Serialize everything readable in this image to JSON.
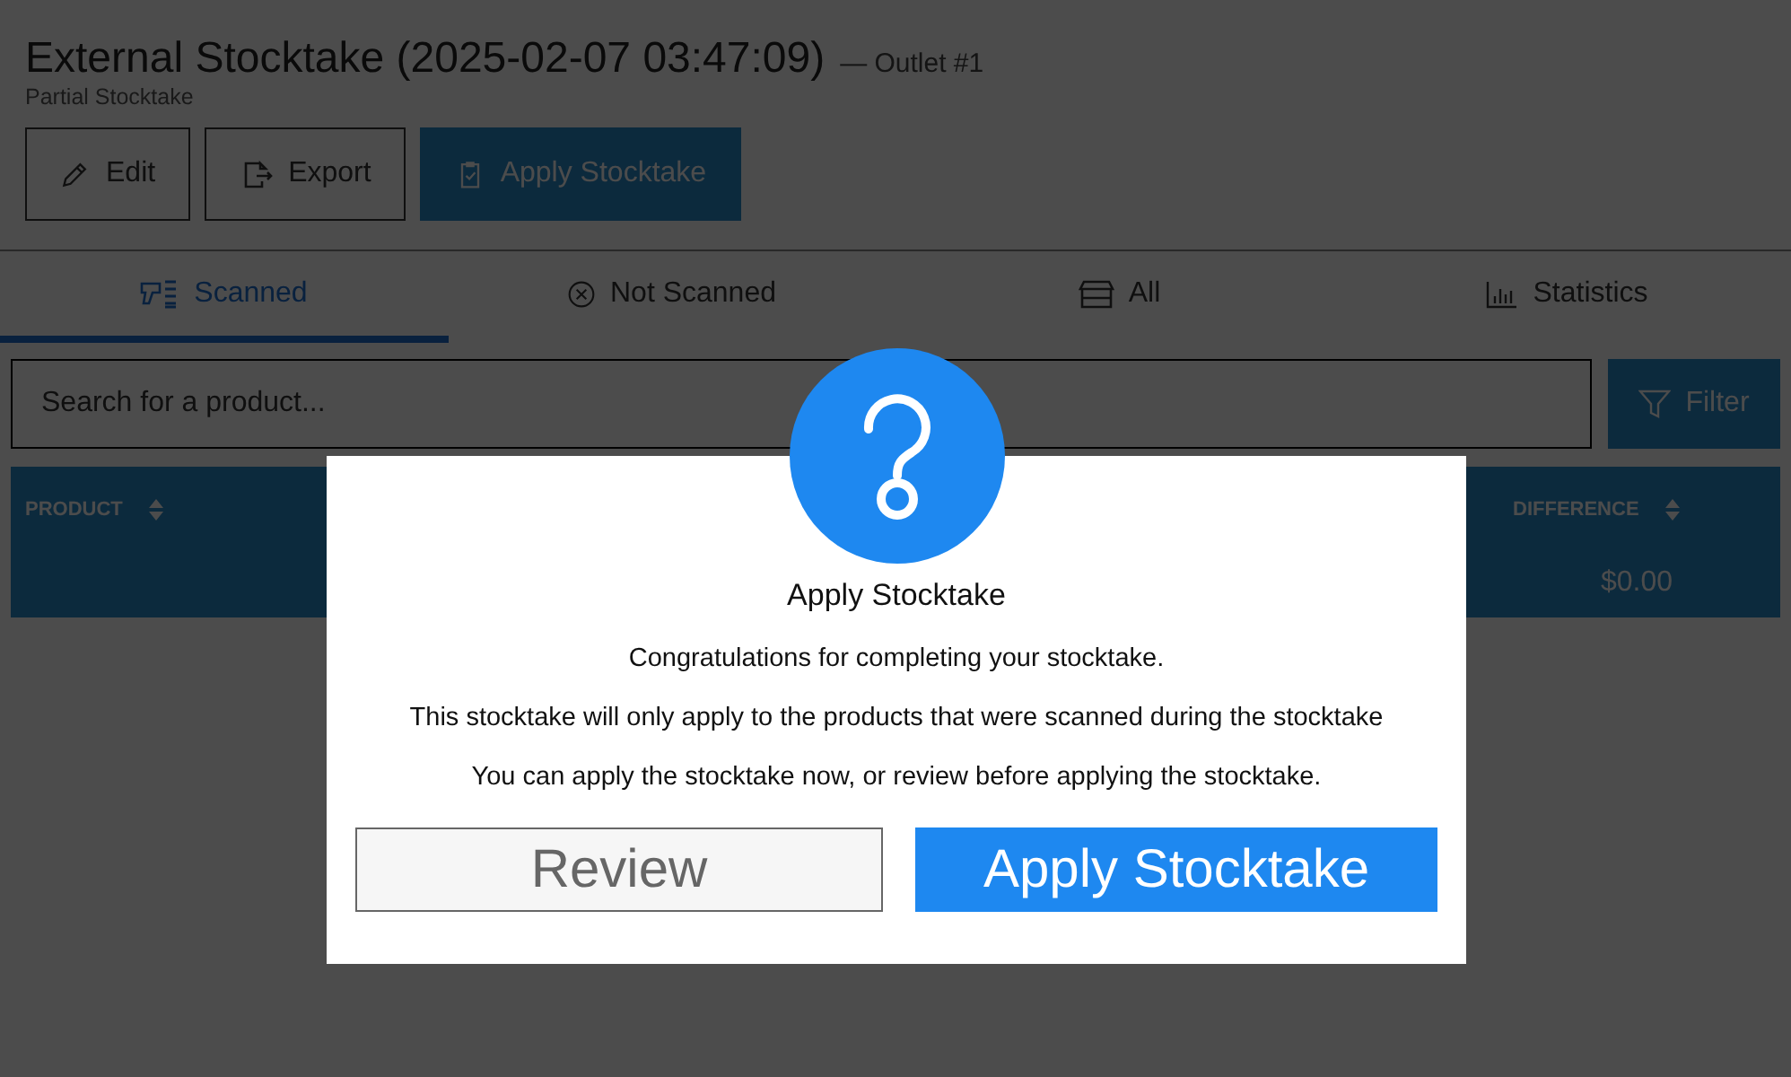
{
  "header": {
    "title": "External Stocktake (2025-02-07 03:47:09)",
    "outlet": "— Outlet #1",
    "subtitle": "Partial Stocktake"
  },
  "actions": [
    {
      "label": "Edit",
      "kind": "edit"
    },
    {
      "label": "Export",
      "kind": "export"
    },
    {
      "label": "Apply Stocktake",
      "kind": "apply"
    }
  ],
  "tabs": [
    {
      "label": "Scanned",
      "kind": "scanned",
      "selected": true
    },
    {
      "label": "Not Scanned",
      "kind": "not-scanned",
      "selected": false
    },
    {
      "label": "All",
      "kind": "all",
      "selected": false
    },
    {
      "label": "Statistics",
      "kind": "statistics",
      "selected": false
    }
  ],
  "search": {
    "placeholder": "Search for a product..."
  },
  "filter_button": "Filter",
  "table": {
    "columns": [
      "PRODUCT",
      "DIFFERENCE"
    ],
    "rows": [
      {
        "difference": "$0.00"
      }
    ]
  },
  "dialog": {
    "title": "Apply Stocktake",
    "messages": [
      "Congratulations for completing your stocktake.",
      "This stocktake will only apply to the products that were scanned during the stocktake",
      "You can apply the stocktake now, or review before applying the stocktake."
    ],
    "buttons": [
      {
        "label": "Review",
        "kind": "secondary"
      },
      {
        "label": "Apply Stocktake",
        "kind": "primary"
      }
    ]
  }
}
